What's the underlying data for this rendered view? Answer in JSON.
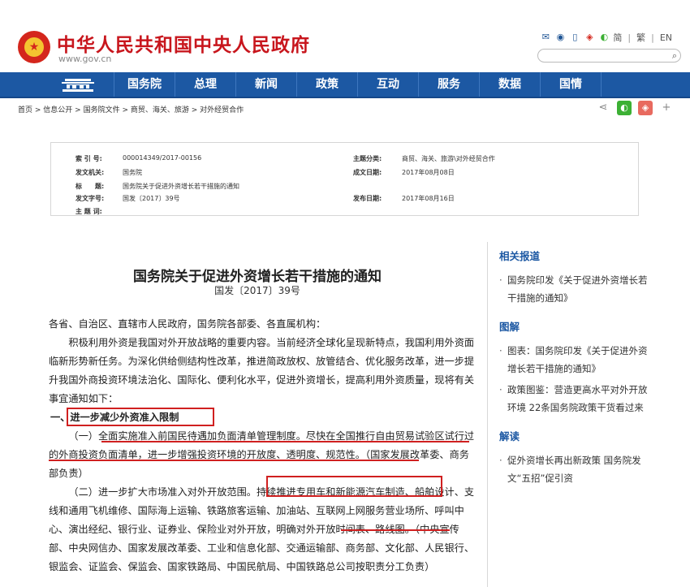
{
  "header": {
    "site_title": "中华人民共和国中央人民政府",
    "site_url": "www.gov.cn",
    "lang_simplified": "简",
    "lang_traditional": "繁",
    "lang_english": "EN",
    "search_placeholder": ""
  },
  "nav": {
    "items": [
      "国务院",
      "总理",
      "新闻",
      "政策",
      "互动",
      "服务",
      "数据",
      "国情"
    ]
  },
  "breadcrumb": [
    "首页",
    "信息公开",
    "国务院文件",
    "商贸、海关、旅游",
    "对外经贸合作"
  ],
  "info_box": {
    "index_label": "索 引 号:",
    "index_value": "000014349/2017-00156",
    "topic_label": "主题分类:",
    "topic_value": "商贸、海关、旅游\\对外经贸合作",
    "issuer_label": "发文机关:",
    "issuer_value": "国务院",
    "written_label": "成文日期:",
    "written_value": "2017年08月08日",
    "title_label": "标　　题:",
    "title_value": "国务院关于促进外资增长若干措施的通知",
    "docno_label": "发文字号:",
    "docno_value": "国发〔2017〕39号",
    "published_label": "发布日期:",
    "published_value": "2017年08月16日",
    "keywords_label": "主 题 词:",
    "keywords_value": ""
  },
  "article": {
    "title": "国务院关于促进外资增长若干措施的通知",
    "doc_number": "国发〔2017〕39号",
    "greeting": "各省、自治区、直辖市人民政府，国务院各部委、各直属机构：",
    "intro": "积极利用外资是我国对外开放战略的重要内容。当前经济全球化呈现新特点，我国利用外资面临新形势新任务。为深化供给侧结构性改革，推进简政放权、放管结合、优化服务改革，进一步提升我国外商投资环境法治化、国际化、便利化水平，促进外资增长，提高利用外资质量，现将有关事宜通知如下：",
    "section1": "一、进一步减少外资准入限制",
    "item1": "（一）全面实施准入前国民待遇加负面清单管理制度。尽快在全国推行自由贸易试验区试行过的外商投资负面清单，进一步增强投资环境的开放度、透明度、规范性。（国家发展改革委、商务部负责）",
    "item2": "（二）进一步扩大市场准入对外开放范围。持续推进专用车和新能源汽车制造、船舶设计、支线和通用飞机维修、国际海上运输、铁路旅客运输、加油站、互联网上网服务营业场所、呼叫中心、演出经纪、银行业、证券业、保险业对外开放，明确对外开放时间表、路线图。（中央宣传部、中央网信办、国家发展改革委、工业和信息化部、交通运输部、商务部、文化部、人民银行、银监会、证监会、保监会、国家铁路局、中国民航局、中国铁路总公司按职责分工负责）"
  },
  "sidebar": {
    "related_title": "相关报道",
    "related_items": [
      "国务院印发《关于促进外资增长若干措施的通知》"
    ],
    "graphic_title": "图解",
    "graphic_items": [
      "图表：国务院印发《关于促进外资增长若干措施的通知》",
      "政策图鉴：营造更高水平对外开放环境 22条国务院政策干货看过来"
    ],
    "interpret_title": "解读",
    "interpret_items": [
      "促外资增长再出新政策 国务院发文“五招”促引资"
    ]
  },
  "colors": {
    "brand_red": "#c8161d",
    "nav_blue": "#1c58a3",
    "highlight_red": "#d02020"
  }
}
